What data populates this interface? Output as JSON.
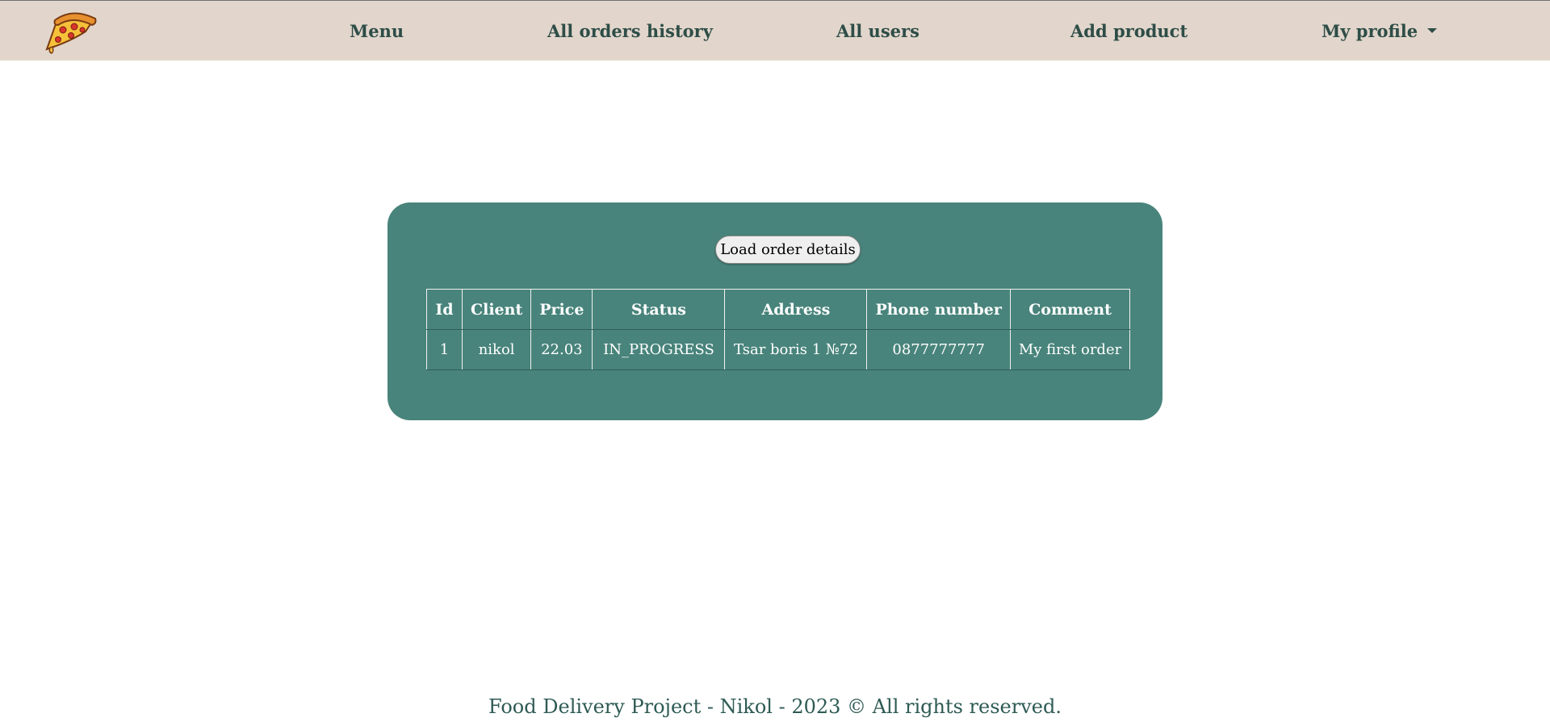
{
  "navbar": {
    "logo_icon": "pizza-slice-icon",
    "items": [
      {
        "label": "Menu"
      },
      {
        "label": "All orders history"
      },
      {
        "label": "All users"
      },
      {
        "label": "Add product"
      },
      {
        "label": "My profile"
      }
    ],
    "background": "#e2d6cc",
    "text_color": "#2e4d47"
  },
  "order_panel": {
    "load_button_label": "Load order details",
    "background": "#48847b",
    "table": {
      "headers": [
        "Id",
        "Client",
        "Price",
        "Status",
        "Address",
        "Phone number",
        "Comment"
      ],
      "rows": [
        [
          "1",
          "nikol",
          "22.03",
          "IN_PROGRESS",
          "Tsar boris 1 №72",
          "0877777777",
          "My first order"
        ]
      ]
    }
  },
  "footer": {
    "text": "Food Delivery Project - Nikol - 2023 © All rights reserved."
  }
}
